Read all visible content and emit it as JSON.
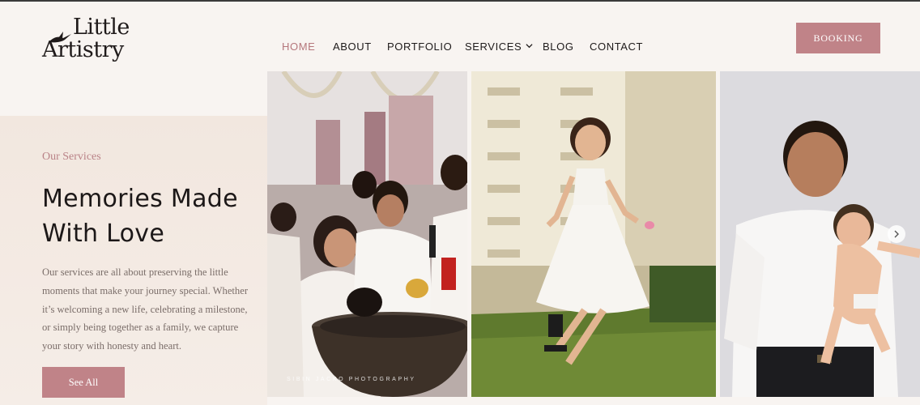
{
  "brand": {
    "line1": "Little",
    "line2": "Artistry"
  },
  "nav": {
    "items": [
      {
        "label": "HOME",
        "active": true
      },
      {
        "label": "ABOUT"
      },
      {
        "label": "PORTFOLIO"
      },
      {
        "label": "SERVICES",
        "dropdown": true
      },
      {
        "label": "BLOG"
      },
      {
        "label": "CONTACT"
      }
    ]
  },
  "booking_label": "BOOKING",
  "hero": {
    "eyebrow": "Our Services",
    "headline_line1": "Memories Made",
    "headline_line2": "With Love",
    "body": "Our services are all about preserving the little moments that make your journey special. Whether it’s welcoming a new life, celebrating a milestone, or simply being together as a family, we capture your story with honesty and heart.",
    "cta": "See All"
  },
  "gallery": {
    "watermark": "SIBIN JACKO PHOTOGRAPHY",
    "photos": [
      "baptism-photo",
      "girl-in-white-dress-photo",
      "father-with-baby-photo"
    ],
    "next_icon": "chevron-right-icon"
  },
  "colors": {
    "accent": "#c08388",
    "active_nav": "#b5777c",
    "panel": "#f2e7df",
    "background": "#f8f4f1"
  }
}
